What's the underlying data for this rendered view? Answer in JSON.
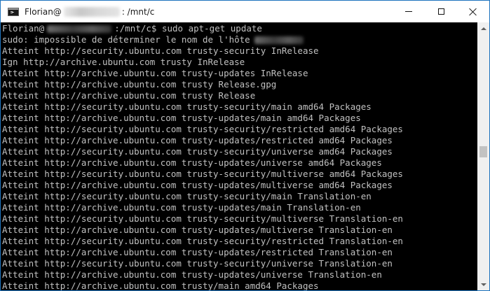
{
  "window": {
    "title_prefix": "Florian@",
    "title_suffix": ": /mnt/c",
    "icon": "terminal-icon",
    "controls": [
      "minimize-icon",
      "maximize-icon",
      "close-icon"
    ]
  },
  "console": {
    "prompt_user": "Florian@",
    "prompt_path": ":/mnt/c$ ",
    "command": "sudo apt-get update",
    "sudo_warning": "sudo: impossible de déterminer le nom de l'hôte",
    "lines": [
      "Atteint http://security.ubuntu.com trusty-security InRelease",
      "Ign http://archive.ubuntu.com trusty InRelease",
      "Atteint http://archive.ubuntu.com trusty-updates InRelease",
      "Atteint http://archive.ubuntu.com trusty Release.gpg",
      "Atteint http://archive.ubuntu.com trusty Release",
      "Atteint http://security.ubuntu.com trusty-security/main amd64 Packages",
      "Atteint http://archive.ubuntu.com trusty-updates/main amd64 Packages",
      "Atteint http://security.ubuntu.com trusty-security/restricted amd64 Packages",
      "Atteint http://archive.ubuntu.com trusty-updates/restricted amd64 Packages",
      "Atteint http://security.ubuntu.com trusty-security/universe amd64 Packages",
      "Atteint http://archive.ubuntu.com trusty-updates/universe amd64 Packages",
      "Atteint http://security.ubuntu.com trusty-security/multiverse amd64 Packages",
      "Atteint http://archive.ubuntu.com trusty-updates/multiverse amd64 Packages",
      "Atteint http://security.ubuntu.com trusty-security/main Translation-en",
      "Atteint http://archive.ubuntu.com trusty-updates/main Translation-en",
      "Atteint http://security.ubuntu.com trusty-security/multiverse Translation-en",
      "Atteint http://archive.ubuntu.com trusty-updates/multiverse Translation-en",
      "Atteint http://security.ubuntu.com trusty-security/restricted Translation-en",
      "Atteint http://archive.ubuntu.com trusty-updates/restricted Translation-en",
      "Atteint http://security.ubuntu.com trusty-security/universe Translation-en",
      "Atteint http://archive.ubuntu.com trusty-updates/universe Translation-en",
      "Atteint http://archive.ubuntu.com trusty/main amd64 Packages"
    ]
  },
  "colors": {
    "console_bg": "#000000",
    "console_text": "#c0c0c0",
    "title_bg": "#ffffff",
    "window_border": "#1e73be"
  }
}
